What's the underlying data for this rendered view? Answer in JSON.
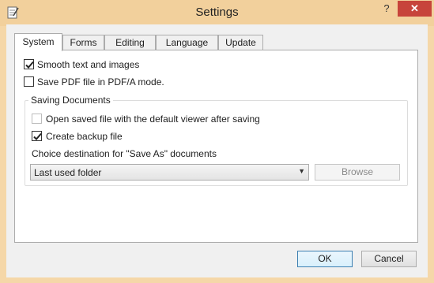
{
  "window": {
    "title": "Settings",
    "help_label": "?",
    "close_label": "✕",
    "colors": {
      "frame": "#f2d09c",
      "close": "#c7443b"
    }
  },
  "tabs": [
    {
      "label": "System",
      "active": true
    },
    {
      "label": "Forms",
      "active": false
    },
    {
      "label": "Editing",
      "active": false
    },
    {
      "label": "Language",
      "active": false
    },
    {
      "label": "Update",
      "active": false
    }
  ],
  "options": {
    "smooth_text": {
      "label": "Smooth text and images",
      "checked": true
    },
    "pdfa": {
      "label": "Save PDF file in PDF/A mode.",
      "checked": false
    }
  },
  "saving": {
    "group_title": "Saving Documents",
    "open_after_save": {
      "label": "Open saved file with the default viewer after saving",
      "checked": false,
      "enabled": false
    },
    "create_backup": {
      "label": "Create backup file",
      "checked": true
    },
    "destination_label": "Choice destination for \"Save As\" documents",
    "destination_value": "Last used folder",
    "browse_label": "Browse"
  },
  "footer": {
    "ok_label": "OK",
    "cancel_label": "Cancel"
  }
}
